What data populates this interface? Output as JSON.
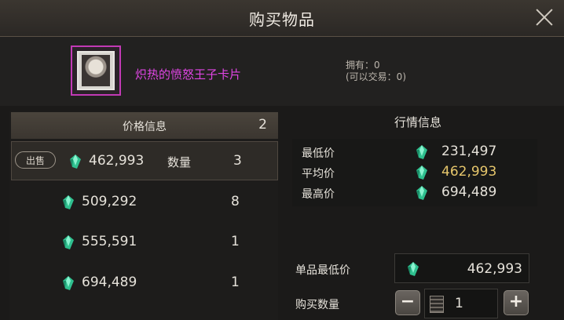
{
  "dialog": {
    "title": "购买物品",
    "close_icon": "close-icon"
  },
  "item": {
    "name": "炽热的愤怒王子卡片",
    "name_color": "#e045e4",
    "owned_label": "拥有：0",
    "tradable_label": "(可以交易：0)",
    "card_frame_color": "#c23ab5"
  },
  "price_info": {
    "header": "价格信息",
    "count": "2",
    "sell_button": "出售",
    "qty_label": "数量",
    "rows": [
      {
        "price": "462,993",
        "qty": "3"
      },
      {
        "price": "509,292",
        "qty": "8"
      },
      {
        "price": "555,591",
        "qty": "1"
      },
      {
        "price": "694,489",
        "qty": "1"
      }
    ]
  },
  "market": {
    "header": "行情信息",
    "rows": [
      {
        "label": "最低价",
        "value": "231,497"
      },
      {
        "label": "平均价",
        "value": "462,993",
        "color": "#e7c76c"
      },
      {
        "label": "最高价",
        "value": "694,489"
      }
    ]
  },
  "purchase": {
    "unit_min_label": "单品最低价",
    "unit_min_value": "462,993",
    "quantity_label": "购买数量",
    "quantity_value": "1",
    "minus": "−",
    "plus": "+"
  },
  "icons": {
    "currency": "green-gem-icon",
    "keypad": "keypad-icon"
  },
  "colors": {
    "accent_gold": "#e7c76c",
    "gem": "#3fd7a6"
  }
}
